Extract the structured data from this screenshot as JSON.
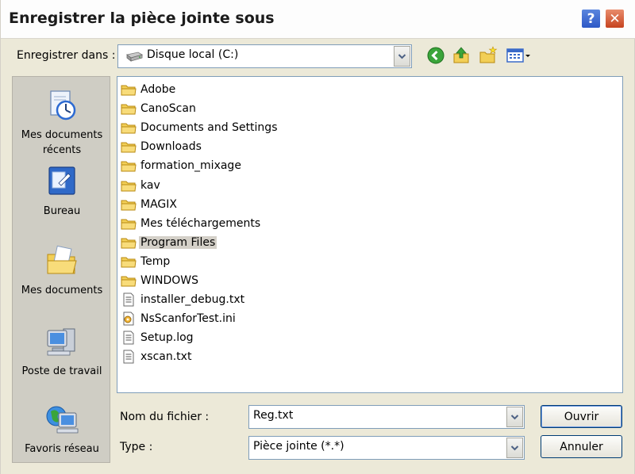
{
  "window": {
    "title": "Enregistrer la pièce jointe sous",
    "help_label": "?",
    "close_label": "✕"
  },
  "lookin": {
    "label": "Enregistrer dans :",
    "value": "Disque local (C:)"
  },
  "toolbar": {
    "icons": [
      "back-icon",
      "up-folder-icon",
      "new-folder-icon",
      "view-menu-icon"
    ]
  },
  "places": [
    {
      "label": "Mes documents\nrécents",
      "icon": "recent-documents-icon"
    },
    {
      "label": "Bureau",
      "icon": "desktop-icon"
    },
    {
      "label": "Mes documents",
      "icon": "my-documents-icon"
    },
    {
      "label": "Poste de travail",
      "icon": "my-computer-icon"
    },
    {
      "label": "Favoris réseau",
      "icon": "network-places-icon"
    }
  ],
  "files": [
    {
      "name": "Adobe",
      "kind": "folder"
    },
    {
      "name": "CanoScan",
      "kind": "folder"
    },
    {
      "name": "Documents and Settings",
      "kind": "folder"
    },
    {
      "name": "Downloads",
      "kind": "folder"
    },
    {
      "name": "formation_mixage",
      "kind": "folder"
    },
    {
      "name": "kav",
      "kind": "folder"
    },
    {
      "name": "MAGIX",
      "kind": "folder"
    },
    {
      "name": "Mes téléchargements",
      "kind": "folder"
    },
    {
      "name": "Program Files",
      "kind": "folder",
      "selected": true
    },
    {
      "name": "Temp",
      "kind": "folder"
    },
    {
      "name": "WINDOWS",
      "kind": "folder"
    },
    {
      "name": "installer_debug.txt",
      "kind": "text"
    },
    {
      "name": "NsScanforTest.ini",
      "kind": "ini"
    },
    {
      "name": "Setup.log",
      "kind": "text"
    },
    {
      "name": "xscan.txt",
      "kind": "text"
    }
  ],
  "filename": {
    "label": "Nom du fichier :",
    "value": "Reg.txt"
  },
  "filetype": {
    "label": "Type :",
    "value": "Pièce jointe (*.*)"
  },
  "buttons": {
    "open": "Ouvrir",
    "cancel": "Annuler"
  }
}
